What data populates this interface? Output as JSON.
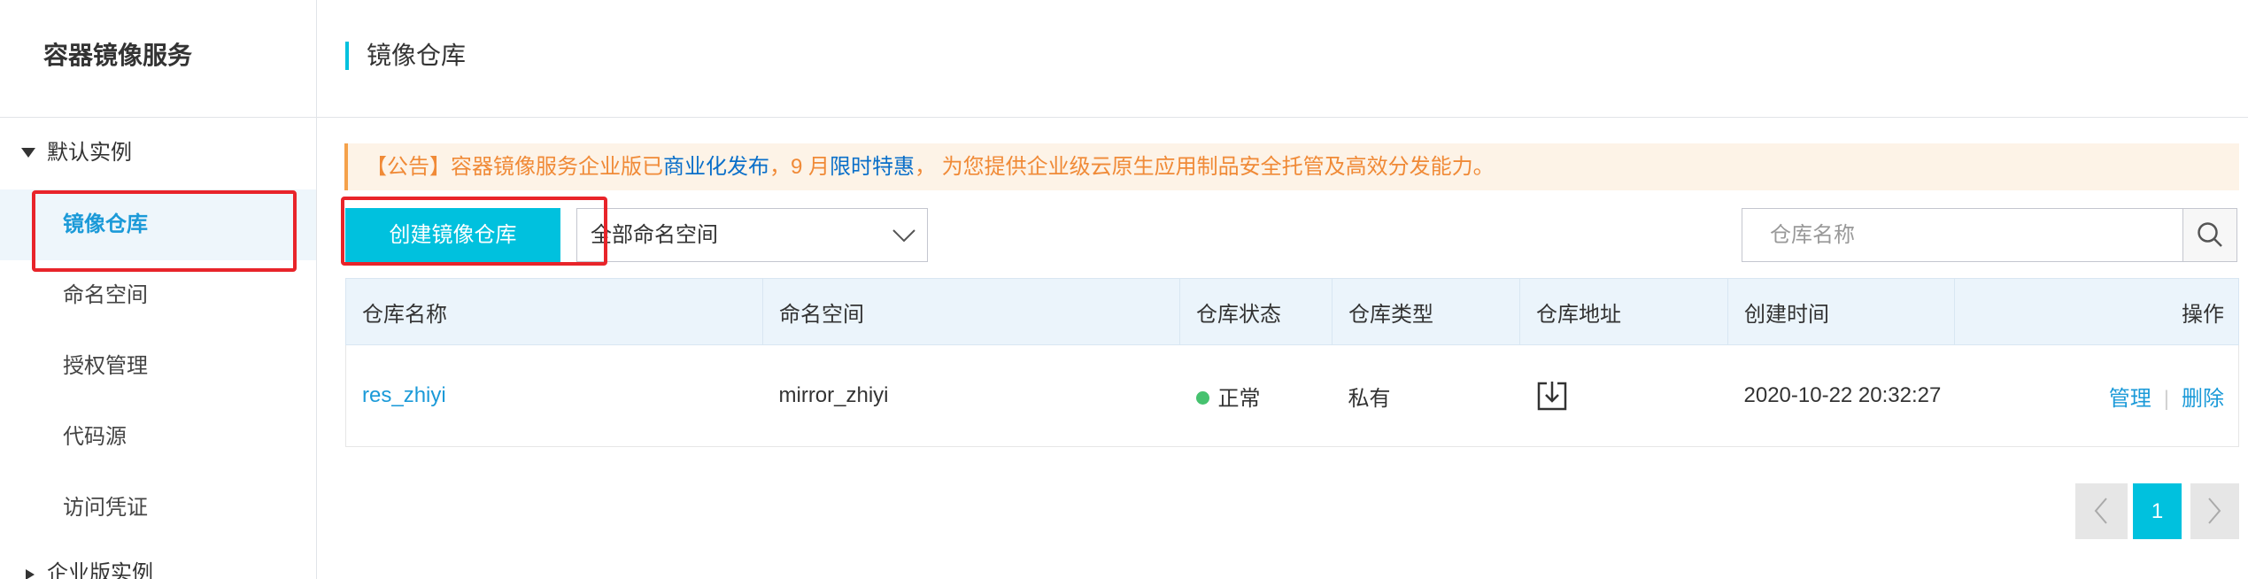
{
  "sidebar": {
    "title": "容器镜像服务",
    "groups": [
      {
        "label": "默认实例",
        "expanded": true,
        "caret_icon": "caret-down-icon",
        "items": [
          {
            "label": "镜像仓库",
            "active": true
          },
          {
            "label": "命名空间",
            "active": false
          },
          {
            "label": "授权管理",
            "active": false
          },
          {
            "label": "代码源",
            "active": false
          },
          {
            "label": "访问凭证",
            "active": false
          }
        ]
      },
      {
        "label": "企业版实例",
        "expanded": false,
        "caret_icon": "caret-right-icon"
      }
    ]
  },
  "main": {
    "title": "镜像仓库",
    "notice": {
      "text_before": "【公告】容器镜像服务企业版已",
      "link_release": "商业化发布",
      "text_middle": "，9 月",
      "link_promo": "限时特惠",
      "text_after": "， 为您提供企业级云原生应用制品安全托管及高效分发能力。"
    },
    "toolbar": {
      "create_button": "创建镜像仓库",
      "namespace_select": {
        "selected": "全部命名空间",
        "icon": "chevron-down-icon"
      },
      "search": {
        "placeholder": "仓库名称",
        "icon": "search-icon"
      }
    },
    "table": {
      "columns": [
        "仓库名称",
        "命名空间",
        "仓库状态",
        "仓库类型",
        "仓库地址",
        "创建时间",
        "操作"
      ],
      "rows": [
        {
          "name": "res_zhiyi",
          "namespace": "mirror_zhiyi",
          "status": "正常",
          "type": "私有",
          "address_icon": "download-icon",
          "created_at": "2020-10-22 20:32:27",
          "actions": [
            "管理",
            "删除"
          ],
          "action_separator": "|"
        }
      ]
    },
    "pagination": {
      "prev_icon": "chevron-left-icon",
      "current_page": "1",
      "next_icon": "chevron-right-icon"
    }
  },
  "colors": {
    "accent": "#00c1de",
    "link": "#1b9ad8",
    "notice_text": "#f08a37",
    "notice_link": "#0a6fc9",
    "notice_border": "#f5a14a",
    "notice_background": "#fdf3e7",
    "status_ok": "#46c26f",
    "table_header_background": "#ebf4fb",
    "annotation": "#e8242a"
  }
}
